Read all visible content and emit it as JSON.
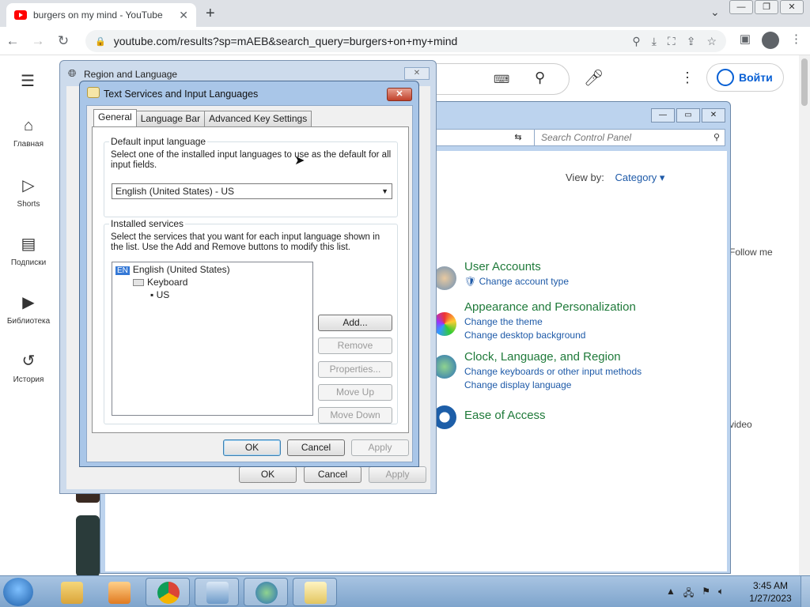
{
  "browser": {
    "tab_title": "burgers on my mind - YouTube",
    "url": "youtube.com/results?sp=mAEB&search_query=burgers+on+my+mind"
  },
  "youtube": {
    "signin_label": "Войти",
    "sidebar": [
      {
        "label": "Главная",
        "icon": "home-icon"
      },
      {
        "label": "Shorts",
        "icon": "shorts-icon"
      },
      {
        "label": "Подписки",
        "icon": "subscriptions-icon"
      },
      {
        "label": "Библиотека",
        "icon": "library-icon"
      },
      {
        "label": "История",
        "icon": "history-icon"
      }
    ],
    "partial_text_1": "Follow me",
    "partial_text_2": "video"
  },
  "control_panel": {
    "search_placeholder": "Search Control Panel",
    "view_by_label": "View by:",
    "view_by_value": "Category",
    "sections": [
      {
        "title": "User Accounts",
        "links": [
          "Change account type"
        ]
      },
      {
        "title": "Appearance and Personalization",
        "links": [
          "Change the theme",
          "Change desktop background"
        ]
      },
      {
        "title": "Clock, Language, and Region",
        "links": [
          "Change keyboards or other input methods",
          "Change display language"
        ]
      },
      {
        "title": "Ease of Access",
        "links": []
      }
    ]
  },
  "region_dialog": {
    "title": "Region and Language",
    "ok": "OK",
    "cancel": "Cancel",
    "apply": "Apply"
  },
  "text_services": {
    "title": "Text Services and Input Languages",
    "tabs": [
      "General",
      "Language Bar",
      "Advanced Key Settings"
    ],
    "default_group_label": "Default input language",
    "default_desc": "Select one of the installed input languages to use as the default for all input fields.",
    "default_value": "English (United States) - US",
    "installed_group_label": "Installed services",
    "installed_desc": "Select the services that you want for each input language shown in the list. Use the Add and Remove buttons to modify this list.",
    "tree": {
      "lang_badge": "EN",
      "language": "English (United States)",
      "category": "Keyboard",
      "layout": "US"
    },
    "buttons": {
      "add": "Add...",
      "remove": "Remove",
      "properties": "Properties...",
      "move_up": "Move Up",
      "move_down": "Move Down",
      "ok": "OK",
      "cancel": "Cancel",
      "apply": "Apply"
    }
  },
  "taskbar": {
    "time": "3:45 AM",
    "date": "1/27/2023"
  }
}
